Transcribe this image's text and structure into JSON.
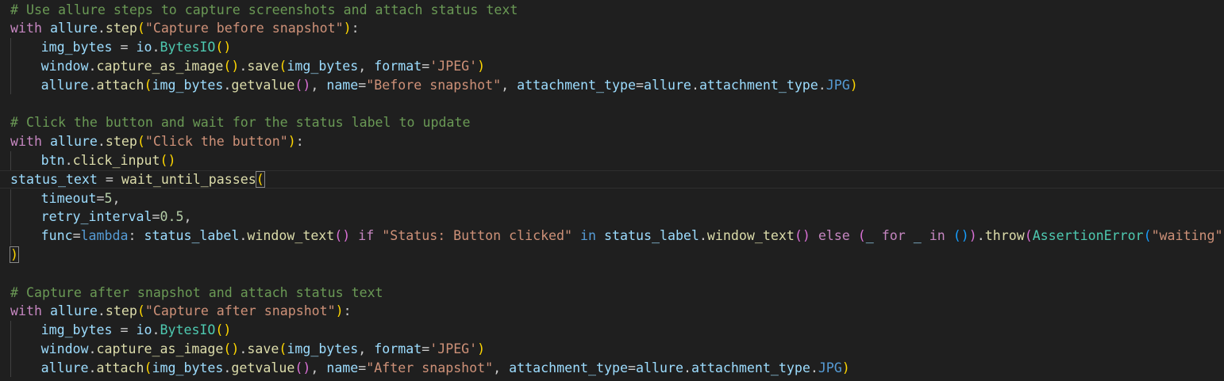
{
  "editor": {
    "lines": [
      {
        "tokens": [
          {
            "t": "# Use allure steps to capture screenshots and attach status text",
            "c": "comment"
          }
        ]
      },
      {
        "tokens": [
          {
            "t": "with",
            "c": "keyword"
          },
          {
            "t": " ",
            "c": "plain"
          },
          {
            "t": "allure",
            "c": "var"
          },
          {
            "t": ".",
            "c": "plain"
          },
          {
            "t": "step",
            "c": "func"
          },
          {
            "t": "(",
            "c": "paren1"
          },
          {
            "t": "\"Capture before snapshot\"",
            "c": "string"
          },
          {
            "t": ")",
            "c": "paren1"
          },
          {
            "t": ":",
            "c": "plain"
          }
        ]
      },
      {
        "indent": 1,
        "tokens": [
          {
            "t": "img_bytes",
            "c": "var"
          },
          {
            "t": " = ",
            "c": "plain"
          },
          {
            "t": "io",
            "c": "var"
          },
          {
            "t": ".",
            "c": "plain"
          },
          {
            "t": "BytesIO",
            "c": "class"
          },
          {
            "t": "()",
            "c": "paren1"
          }
        ]
      },
      {
        "indent": 1,
        "tokens": [
          {
            "t": "window",
            "c": "var"
          },
          {
            "t": ".",
            "c": "plain"
          },
          {
            "t": "capture_as_image",
            "c": "func"
          },
          {
            "t": "()",
            "c": "paren1"
          },
          {
            "t": ".",
            "c": "plain"
          },
          {
            "t": "save",
            "c": "func"
          },
          {
            "t": "(",
            "c": "paren1"
          },
          {
            "t": "img_bytes",
            "c": "var"
          },
          {
            "t": ", ",
            "c": "plain"
          },
          {
            "t": "format",
            "c": "var"
          },
          {
            "t": "=",
            "c": "plain"
          },
          {
            "t": "'JPEG'",
            "c": "string"
          },
          {
            "t": ")",
            "c": "paren1"
          }
        ]
      },
      {
        "indent": 1,
        "tokens": [
          {
            "t": "allure",
            "c": "var"
          },
          {
            "t": ".",
            "c": "plain"
          },
          {
            "t": "attach",
            "c": "func"
          },
          {
            "t": "(",
            "c": "paren1"
          },
          {
            "t": "img_bytes",
            "c": "var"
          },
          {
            "t": ".",
            "c": "plain"
          },
          {
            "t": "getvalue",
            "c": "func"
          },
          {
            "t": "()",
            "c": "paren2"
          },
          {
            "t": ", ",
            "c": "plain"
          },
          {
            "t": "name",
            "c": "var"
          },
          {
            "t": "=",
            "c": "plain"
          },
          {
            "t": "\"Before snapshot\"",
            "c": "string"
          },
          {
            "t": ", ",
            "c": "plain"
          },
          {
            "t": "attachment_type",
            "c": "var"
          },
          {
            "t": "=",
            "c": "plain"
          },
          {
            "t": "allure",
            "c": "var"
          },
          {
            "t": ".",
            "c": "plain"
          },
          {
            "t": "attachment_type",
            "c": "var"
          },
          {
            "t": ".",
            "c": "plain"
          },
          {
            "t": "JPG",
            "c": "kw2"
          },
          {
            "t": ")",
            "c": "paren1"
          }
        ]
      },
      {
        "tokens": []
      },
      {
        "tokens": [
          {
            "t": "# Click the button and wait for the status label to update",
            "c": "comment"
          }
        ]
      },
      {
        "tokens": [
          {
            "t": "with",
            "c": "keyword"
          },
          {
            "t": " ",
            "c": "plain"
          },
          {
            "t": "allure",
            "c": "var"
          },
          {
            "t": ".",
            "c": "plain"
          },
          {
            "t": "step",
            "c": "func"
          },
          {
            "t": "(",
            "c": "paren1"
          },
          {
            "t": "\"Click the button\"",
            "c": "string"
          },
          {
            "t": ")",
            "c": "paren1"
          },
          {
            "t": ":",
            "c": "plain"
          }
        ]
      },
      {
        "indent": 1,
        "tokens": [
          {
            "t": "btn",
            "c": "var"
          },
          {
            "t": ".",
            "c": "plain"
          },
          {
            "t": "click_input",
            "c": "func"
          },
          {
            "t": "()",
            "c": "paren1"
          }
        ]
      },
      {
        "current": true,
        "tokens": [
          {
            "t": "status_text",
            "c": "var"
          },
          {
            "t": " = ",
            "c": "plain"
          },
          {
            "t": "wait_until_passes",
            "c": "func"
          },
          {
            "t": "(",
            "c": "paren1",
            "match": true
          }
        ]
      },
      {
        "indent": 1,
        "tokens": [
          {
            "t": "timeout",
            "c": "var"
          },
          {
            "t": "=",
            "c": "plain"
          },
          {
            "t": "5",
            "c": "number"
          },
          {
            "t": ",",
            "c": "plain"
          }
        ]
      },
      {
        "indent": 1,
        "tokens": [
          {
            "t": "retry_interval",
            "c": "var"
          },
          {
            "t": "=",
            "c": "plain"
          },
          {
            "t": "0.5",
            "c": "number"
          },
          {
            "t": ",",
            "c": "plain"
          }
        ]
      },
      {
        "indent": 1,
        "tokens": [
          {
            "t": "func",
            "c": "var"
          },
          {
            "t": "=",
            "c": "plain"
          },
          {
            "t": "lambda",
            "c": "kw2"
          },
          {
            "t": ": ",
            "c": "plain"
          },
          {
            "t": "status_label",
            "c": "var"
          },
          {
            "t": ".",
            "c": "plain"
          },
          {
            "t": "window_text",
            "c": "func"
          },
          {
            "t": "()",
            "c": "paren2"
          },
          {
            "t": " ",
            "c": "plain"
          },
          {
            "t": "if",
            "c": "keyword"
          },
          {
            "t": " ",
            "c": "plain"
          },
          {
            "t": "\"Status: Button clicked\"",
            "c": "string"
          },
          {
            "t": " ",
            "c": "plain"
          },
          {
            "t": "in",
            "c": "kw2"
          },
          {
            "t": " ",
            "c": "plain"
          },
          {
            "t": "status_label",
            "c": "var"
          },
          {
            "t": ".",
            "c": "plain"
          },
          {
            "t": "window_text",
            "c": "func"
          },
          {
            "t": "()",
            "c": "paren2"
          },
          {
            "t": " ",
            "c": "plain"
          },
          {
            "t": "else",
            "c": "keyword"
          },
          {
            "t": " ",
            "c": "plain"
          },
          {
            "t": "(",
            "c": "paren2"
          },
          {
            "t": "_",
            "c": "var"
          },
          {
            "t": " ",
            "c": "plain"
          },
          {
            "t": "for",
            "c": "keyword"
          },
          {
            "t": " ",
            "c": "plain"
          },
          {
            "t": "_",
            "c": "var"
          },
          {
            "t": " ",
            "c": "plain"
          },
          {
            "t": "in",
            "c": "keyword"
          },
          {
            "t": " ",
            "c": "plain"
          },
          {
            "t": "()",
            "c": "paren3"
          },
          {
            "t": ")",
            "c": "paren2"
          },
          {
            "t": ".",
            "c": "plain"
          },
          {
            "t": "throw",
            "c": "func"
          },
          {
            "t": "(",
            "c": "paren2"
          },
          {
            "t": "AssertionError",
            "c": "class"
          },
          {
            "t": "(",
            "c": "paren3"
          },
          {
            "t": "\"waiting\"",
            "c": "string"
          },
          {
            "t": ")",
            "c": "paren3"
          },
          {
            "t": ")",
            "c": "paren2"
          },
          {
            "t": ",",
            "c": "plain"
          }
        ]
      },
      {
        "tokens": [
          {
            "t": ")",
            "c": "paren1",
            "match": true
          }
        ]
      },
      {
        "tokens": []
      },
      {
        "tokens": [
          {
            "t": "# Capture after snapshot and attach status text",
            "c": "comment"
          }
        ]
      },
      {
        "tokens": [
          {
            "t": "with",
            "c": "keyword"
          },
          {
            "t": " ",
            "c": "plain"
          },
          {
            "t": "allure",
            "c": "var"
          },
          {
            "t": ".",
            "c": "plain"
          },
          {
            "t": "step",
            "c": "func"
          },
          {
            "t": "(",
            "c": "paren1"
          },
          {
            "t": "\"Capture after snapshot\"",
            "c": "string"
          },
          {
            "t": ")",
            "c": "paren1"
          },
          {
            "t": ":",
            "c": "plain"
          }
        ]
      },
      {
        "indent": 1,
        "tokens": [
          {
            "t": "img_bytes",
            "c": "var"
          },
          {
            "t": " = ",
            "c": "plain"
          },
          {
            "t": "io",
            "c": "var"
          },
          {
            "t": ".",
            "c": "plain"
          },
          {
            "t": "BytesIO",
            "c": "class"
          },
          {
            "t": "()",
            "c": "paren1"
          }
        ]
      },
      {
        "indent": 1,
        "tokens": [
          {
            "t": "window",
            "c": "var"
          },
          {
            "t": ".",
            "c": "plain"
          },
          {
            "t": "capture_as_image",
            "c": "func"
          },
          {
            "t": "()",
            "c": "paren1"
          },
          {
            "t": ".",
            "c": "plain"
          },
          {
            "t": "save",
            "c": "func"
          },
          {
            "t": "(",
            "c": "paren1"
          },
          {
            "t": "img_bytes",
            "c": "var"
          },
          {
            "t": ", ",
            "c": "plain"
          },
          {
            "t": "format",
            "c": "var"
          },
          {
            "t": "=",
            "c": "plain"
          },
          {
            "t": "'JPEG'",
            "c": "string"
          },
          {
            "t": ")",
            "c": "paren1"
          }
        ]
      },
      {
        "indent": 1,
        "tokens": [
          {
            "t": "allure",
            "c": "var"
          },
          {
            "t": ".",
            "c": "plain"
          },
          {
            "t": "attach",
            "c": "func"
          },
          {
            "t": "(",
            "c": "paren1"
          },
          {
            "t": "img_bytes",
            "c": "var"
          },
          {
            "t": ".",
            "c": "plain"
          },
          {
            "t": "getvalue",
            "c": "func"
          },
          {
            "t": "()",
            "c": "paren2"
          },
          {
            "t": ", ",
            "c": "plain"
          },
          {
            "t": "name",
            "c": "var"
          },
          {
            "t": "=",
            "c": "plain"
          },
          {
            "t": "\"After snapshot\"",
            "c": "string"
          },
          {
            "t": ", ",
            "c": "plain"
          },
          {
            "t": "attachment_type",
            "c": "var"
          },
          {
            "t": "=",
            "c": "plain"
          },
          {
            "t": "allure",
            "c": "var"
          },
          {
            "t": ".",
            "c": "plain"
          },
          {
            "t": "attachment_type",
            "c": "var"
          },
          {
            "t": ".",
            "c": "plain"
          },
          {
            "t": "JPG",
            "c": "kw2"
          },
          {
            "t": ")",
            "c": "paren1"
          }
        ]
      }
    ]
  }
}
